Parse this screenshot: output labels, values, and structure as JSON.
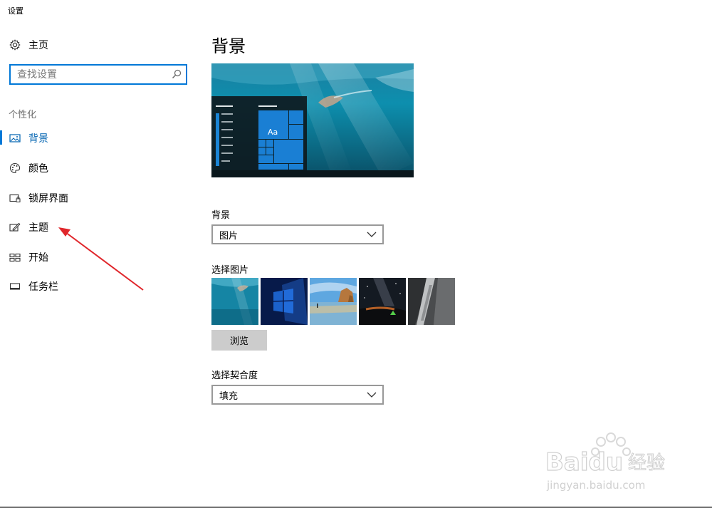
{
  "window": {
    "title": "设置"
  },
  "sidebar": {
    "home_label": "主页",
    "search_placeholder": "查找设置",
    "section_label": "个性化",
    "items": [
      {
        "label": "背景",
        "icon": "picture-icon",
        "active": true
      },
      {
        "label": "颜色",
        "icon": "palette-icon",
        "active": false
      },
      {
        "label": "锁屏界面",
        "icon": "lock-screen-icon",
        "active": false
      },
      {
        "label": "主题",
        "icon": "theme-brush-icon",
        "active": false
      },
      {
        "label": "开始",
        "icon": "start-tiles-icon",
        "active": false
      },
      {
        "label": "任务栏",
        "icon": "taskbar-icon",
        "active": false
      }
    ]
  },
  "main": {
    "title": "背景",
    "preview": {
      "tile_text": "Aa"
    },
    "background": {
      "label": "背景",
      "value": "图片"
    },
    "choose_picture": {
      "label": "选择图片",
      "thumbnails": [
        "underwater-swimmer",
        "windows-hero",
        "beach-sunset",
        "night-sky-tent",
        "rock-cliff"
      ]
    },
    "browse_label": "浏览",
    "fit": {
      "label": "选择契合度",
      "value": "填充"
    }
  },
  "watermark": {
    "brand": "Baidu",
    "cn": "经验",
    "url": "jingyan.baidu.com"
  },
  "colors": {
    "accent": "#0078d7",
    "active_text": "#0063b1",
    "annotation_arrow": "#e0262b"
  }
}
